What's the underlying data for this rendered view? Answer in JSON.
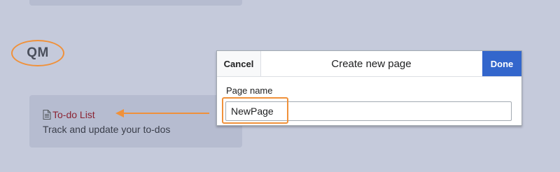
{
  "annotation": {
    "label": "QM",
    "color": "#f0913a"
  },
  "card": {
    "link_text": "To-do List",
    "description": "Track and update your to-dos",
    "link_color": "#8b2332",
    "icon": "document-icon"
  },
  "dialog": {
    "cancel_label": "Cancel",
    "title": "Create new page",
    "done_label": "Done",
    "field_label": "Page name",
    "input_value": "NewPage",
    "accent_color": "#3366cc"
  }
}
